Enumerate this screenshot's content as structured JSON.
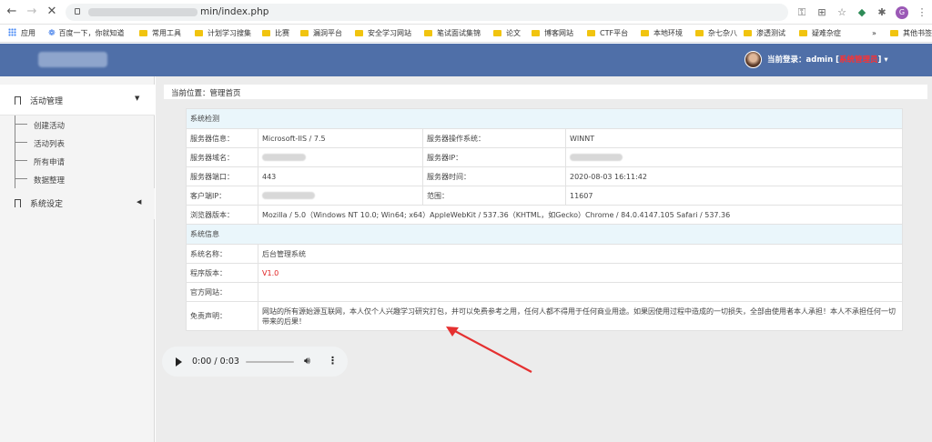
{
  "browser": {
    "url_suffix": "min/index.php",
    "bookmarks": [
      "应用",
      "百度一下，你就知道",
      "常用工具",
      "计划学习搜集",
      "比赛",
      "漏洞平台",
      "安全学习网站",
      "笔试面试集锦",
      "论文",
      "博客网站",
      "CTF平台",
      "本地环境",
      "杂七杂八",
      "渗透测试",
      "疑难杂症"
    ],
    "more_bookmarks": "»",
    "other_bookmarks": "其他书签",
    "profile_initial": "G"
  },
  "header": {
    "login_prefix": "当前登录：admin [",
    "role": "系统管理员",
    "login_suffix": "] ▾"
  },
  "sidebar": {
    "menu1_label": "活动管理",
    "menu1_arrow": "▼",
    "items": [
      "创建活动",
      "活动列表",
      "所有申请",
      "数据整理"
    ],
    "menu2_label": "系统设定",
    "menu2_arrow": "◀"
  },
  "breadcrumb": "当前位置：管理首页",
  "system_check": {
    "title": "系统检测",
    "server_info_label": "服务器信息：",
    "server_info": "Microsoft-IIS / 7.5",
    "os_label": "服务器操作系统：",
    "os": "WINNT",
    "domain_label": "服务器域名：",
    "ip_label": "服务器IP：",
    "port_label": "服务器端口：",
    "port": "443",
    "time_label": "服务器时间：",
    "time": "2020-08-03 16:11:42",
    "client_ip_label": "客户端IP：",
    "range_label": "范围：",
    "range": "11607",
    "browser_label": "浏览器版本：",
    "browser": "Mozilla / 5.0（Windows NT 10.0; Win64; x64）AppleWebKit / 537.36（KHTML，如Gecko）Chrome / 84.0.4147.105 Safari / 537.36"
  },
  "system_info": {
    "title": "系统信息",
    "name_label": "系统名称：",
    "name": "后台管理系统",
    "version_label": "程序版本：",
    "version": "V1.0",
    "website_label": "官方网站：",
    "website": "",
    "disclaimer_label": "免责声明：",
    "disclaimer": "网站的所有源始源互联网，本人仅个人兴趣学习研究打包，并可以免费参考之用，任何人都不得用于任何商业用途。如果因使用过程中造成的一切损失，全部由使用者本人承担！本人不承担任何一切带来的后果！"
  },
  "player": {
    "time": "0:00 / 0:03"
  },
  "colors": {
    "header_bg": "#4f6fa8",
    "role_red": "#ff3030",
    "version_red": "#e02020",
    "section_bg": "#eaf6fb",
    "arrow_red": "#e53030"
  }
}
